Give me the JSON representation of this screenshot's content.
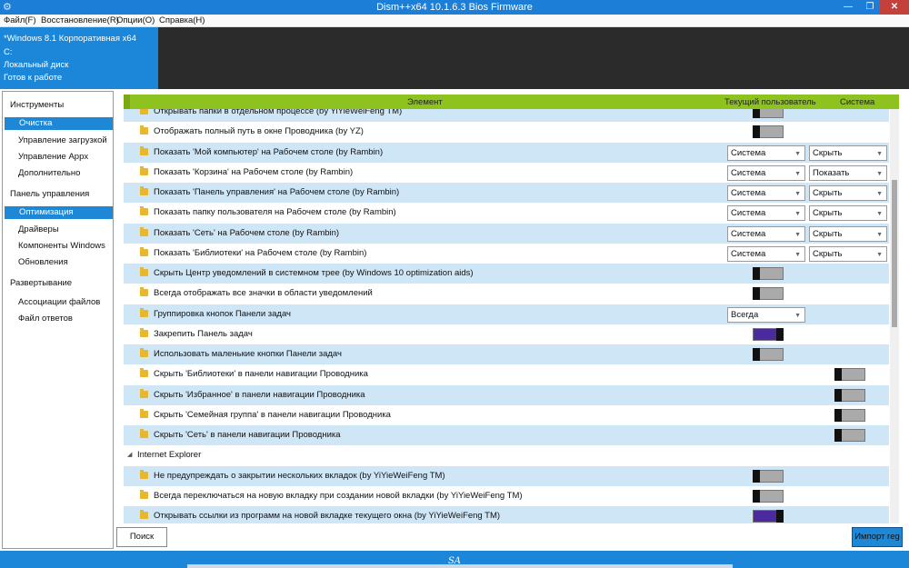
{
  "window": {
    "title": "Dism++x64 10.1.6.3 Bios Firmware"
  },
  "menu": [
    "Файл(F)",
    "Восстановление(R)",
    "Опции(O)",
    "Справка(H)"
  ],
  "info": {
    "os": "*Windows 8.1 Корпоративная x64",
    "drive": "C:",
    "disk": "Локальный диск",
    "status": "Готов к работе"
  },
  "sidebar": {
    "sections": [
      {
        "title": "Инструменты",
        "items": [
          {
            "label": "Очистка",
            "selected": true
          },
          {
            "label": "Управление загрузкой"
          },
          {
            "label": "Управление Appx"
          },
          {
            "label": "Дополнительно"
          }
        ]
      },
      {
        "title": "Панель управления",
        "items": [
          {
            "label": "Оптимизация",
            "selected": true
          },
          {
            "label": "Драйверы"
          },
          {
            "label": "Компоненты Windows"
          },
          {
            "label": "Обновления"
          }
        ]
      },
      {
        "title": "Развертывание",
        "items": [
          {
            "label": "Ассоциации файлов"
          },
          {
            "label": "Файл ответов"
          }
        ]
      }
    ]
  },
  "table": {
    "col_element": "Элемент",
    "col_user": "Текущий пользователь",
    "col_system": "Система"
  },
  "rows": [
    {
      "label": "Открывать папки в отдельном процессе (by YiYieWeiFeng TM)",
      "user": "off"
    },
    {
      "label": "Отображать полный путь в окне Проводника (by YZ)",
      "user": "off"
    },
    {
      "label": "Показать 'Мой компьютер' на Рабочем столе (by Rambin)",
      "user_dd": "Система",
      "sys_dd": "Скрыть"
    },
    {
      "label": "Показать 'Корзина' на Рабочем столе (by Rambin)",
      "user_dd": "Система",
      "sys_dd": "Показать"
    },
    {
      "label": "Показать 'Панель управления' на Рабочем столе (by Rambin)",
      "user_dd": "Система",
      "sys_dd": "Скрыть"
    },
    {
      "label": "Показать папку пользователя на Рабочем столе (by Rambin)",
      "user_dd": "Система",
      "sys_dd": "Скрыть"
    },
    {
      "label": "Показать 'Сеть' на Рабочем столе (by Rambin)",
      "user_dd": "Система",
      "sys_dd": "Скрыть"
    },
    {
      "label": "Показать 'Библиотеки' на Рабочем столе (by Rambin)",
      "user_dd": "Система",
      "sys_dd": "Скрыть"
    },
    {
      "label": "Скрыть Центр уведомлений в системном трее (by Windows 10 optimization aids)",
      "user": "off"
    },
    {
      "label": "Всегда отображать все значки в области уведомлений",
      "user": "off"
    },
    {
      "label": "Группировка кнопок Панели задач",
      "user_dd": "Всегда"
    },
    {
      "label": "Закрепить Панель задач",
      "user": "on"
    },
    {
      "label": "Использовать маленькие кнопки Панели задач",
      "user": "off"
    },
    {
      "label": "Скрыть 'Библиотеки' в панели навигации Проводника",
      "sys": "off"
    },
    {
      "label": "Скрыть 'Избранное' в панели навигации Проводника",
      "sys": "off"
    },
    {
      "label": "Скрыть 'Семейная группа' в панели навигации Проводника",
      "sys": "off"
    },
    {
      "label": "Скрыть 'Сеть' в панели навигации Проводника",
      "sys": "off"
    },
    {
      "label": "Internet Explorer",
      "group": true
    },
    {
      "label": "Не предупреждать о закрытии нескольких вкладок (by YiYieWeiFeng TM)",
      "user": "off"
    },
    {
      "label": "Всегда переключаться на новую вкладку при создании новой вкладки (by YiYieWeiFeng TM)",
      "user": "off"
    },
    {
      "label": "Открывать ссылки из программ  на новой вкладке текущего окна (by YiYieWeiFeng TM)",
      "user": "on"
    }
  ],
  "buttons": {
    "search": "Поиск",
    "import": "Импорт reg"
  },
  "status": {
    "label": "SA"
  }
}
